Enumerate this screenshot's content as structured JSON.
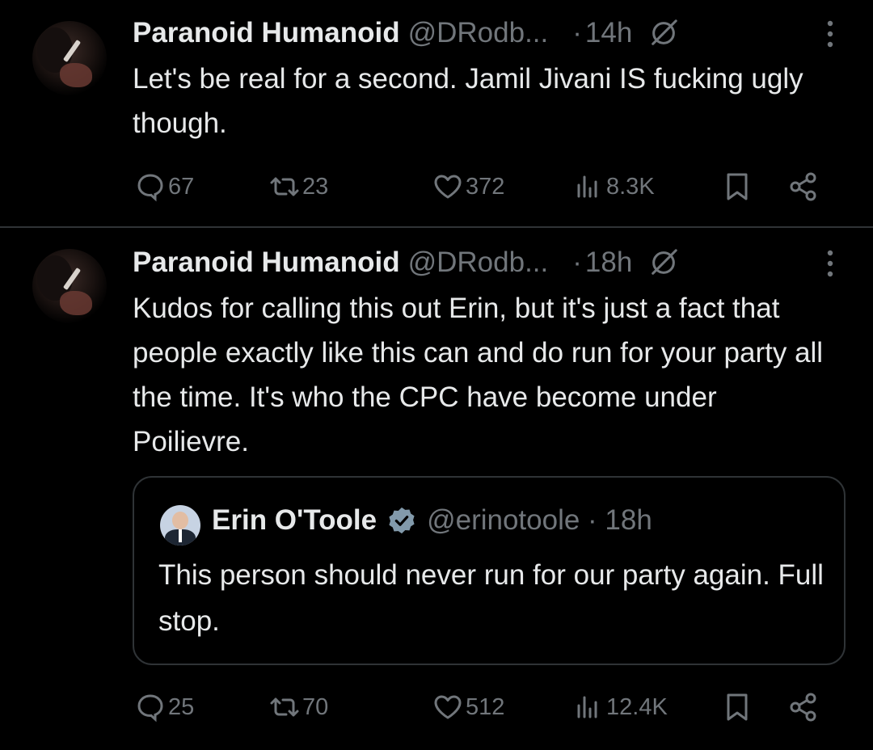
{
  "tweets": [
    {
      "author_name": "Paranoid Humanoid",
      "author_handle": "@DRodb...",
      "separator": "·",
      "time": "14h",
      "text": "Let's be real for a second. Jamil Jivani IS fucking ugly though.",
      "replies": "67",
      "retweets": "23",
      "likes": "372",
      "views": "8.3K"
    },
    {
      "author_name": "Paranoid Humanoid",
      "author_handle": "@DRodb...",
      "separator": "·",
      "time": "18h",
      "text": "Kudos for calling this out Erin, but it's just a fact that people exactly like this can and do run for your party all the time. It's who the CPC have become under Poilievre.",
      "quote": {
        "author_name": "Erin O'Toole",
        "author_handle": "@erinotoole · 18h",
        "text": "This person should never run for our party again. Full stop."
      },
      "replies": "25",
      "retweets": "70",
      "likes": "512",
      "views": "12.4K"
    }
  ],
  "icons": {
    "reply": "speech-bubble-icon",
    "retweet": "retweet-arrows-icon",
    "like": "heart-icon",
    "views": "bar-chart-icon",
    "bookmark": "bookmark-icon",
    "share": "share-icon",
    "more": "vertical-dots-icon",
    "grok": "grok-slash-icon",
    "verified": "verified-badge-icon"
  },
  "colors": {
    "background": "#000000",
    "text_primary": "#e7e9ea",
    "text_secondary": "#71767b",
    "border": "#2f3336",
    "verified_badge": "#829aab"
  }
}
